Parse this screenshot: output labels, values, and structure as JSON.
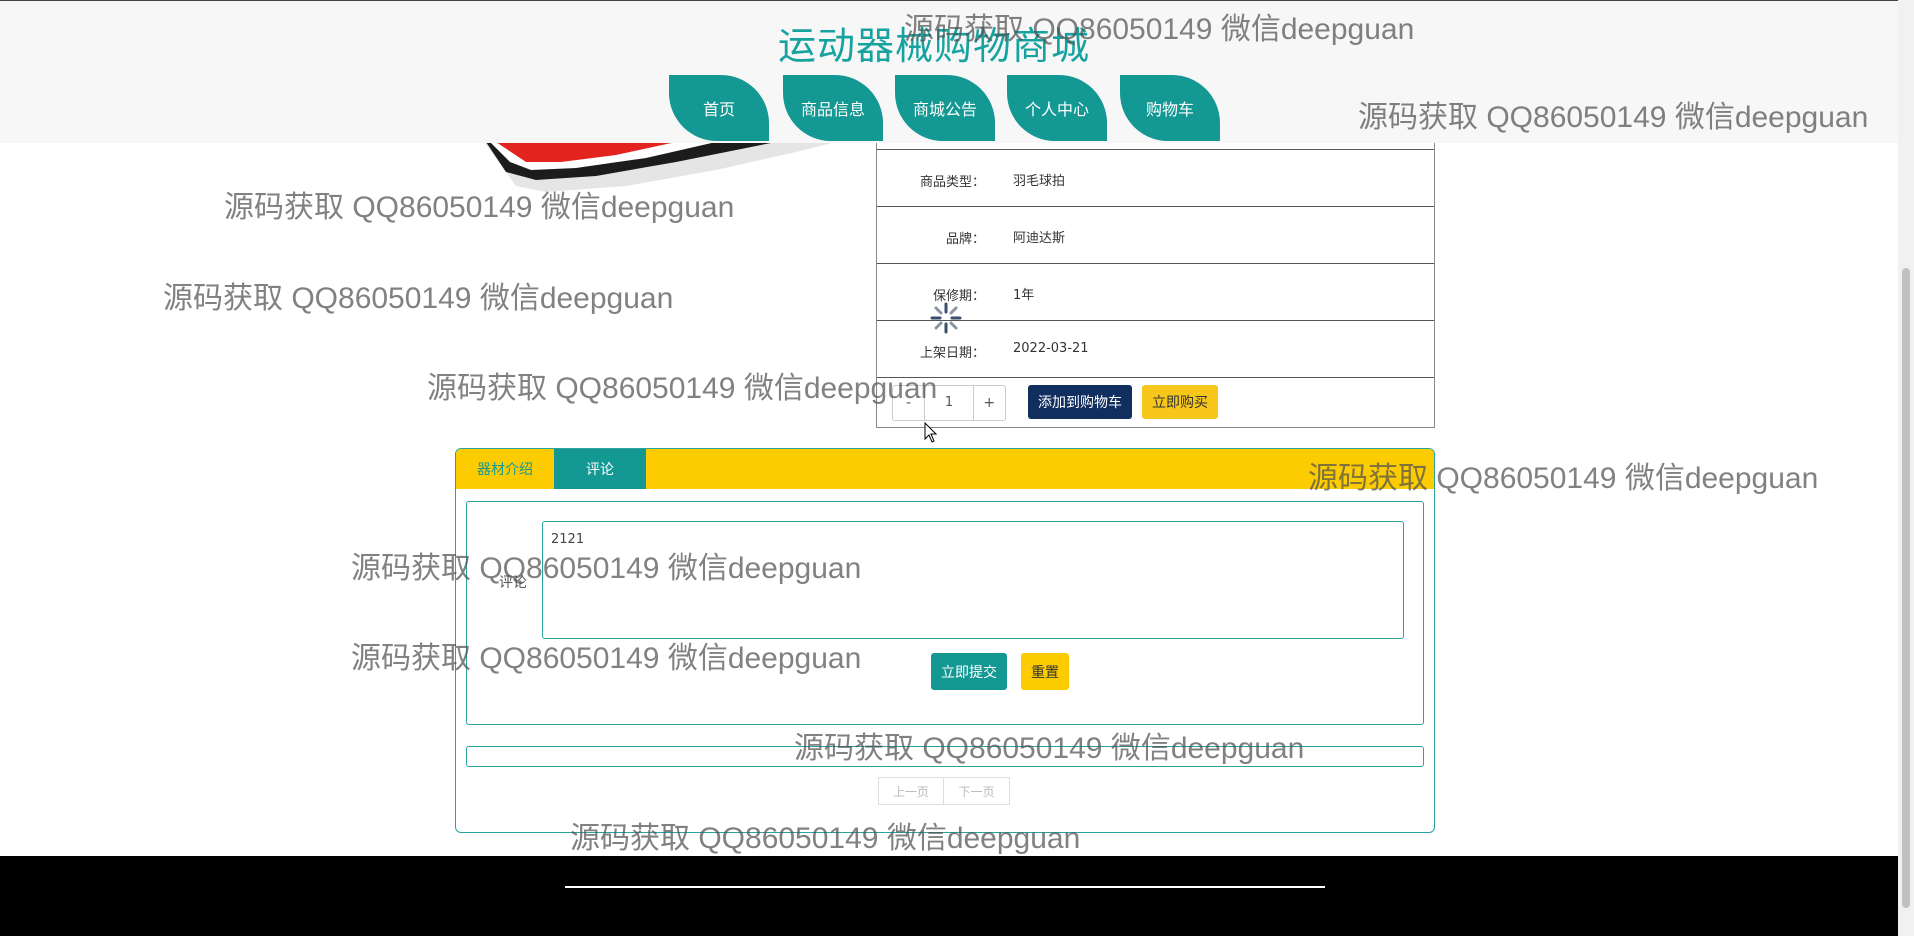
{
  "header": {
    "site_title": "运动器械购物商城",
    "nav": [
      "首页",
      "商品信息",
      "商城公告",
      "个人中心",
      "购物车"
    ]
  },
  "product_info": {
    "rows": [
      {
        "label": "商品类型：",
        "value": "羽毛球拍"
      },
      {
        "label": "品牌：",
        "value": "阿迪达斯"
      },
      {
        "label": "保修期：",
        "value": "1年"
      },
      {
        "label": "上架日期：",
        "value": "2022-03-21"
      }
    ],
    "quantity": {
      "minus": "-",
      "value": "1",
      "plus": "+"
    },
    "add_to_cart_label": "添加到购物车",
    "buy_now_label": "立即购买"
  },
  "tabs": {
    "items": [
      "器材介绍",
      "评论"
    ],
    "active": 1
  },
  "comment_form": {
    "label": "评论",
    "value": "2121",
    "submit_label": "立即提交",
    "reset_label": "重置"
  },
  "pager": {
    "prev": "上一页",
    "next": "下一页"
  },
  "watermark_text": "源码获取 QQ86050149 微信deepguan",
  "colors": {
    "teal": "#149893",
    "yellow": "#fccc00",
    "navy": "#102f5e",
    "buy_yellow": "#f7c61b"
  }
}
